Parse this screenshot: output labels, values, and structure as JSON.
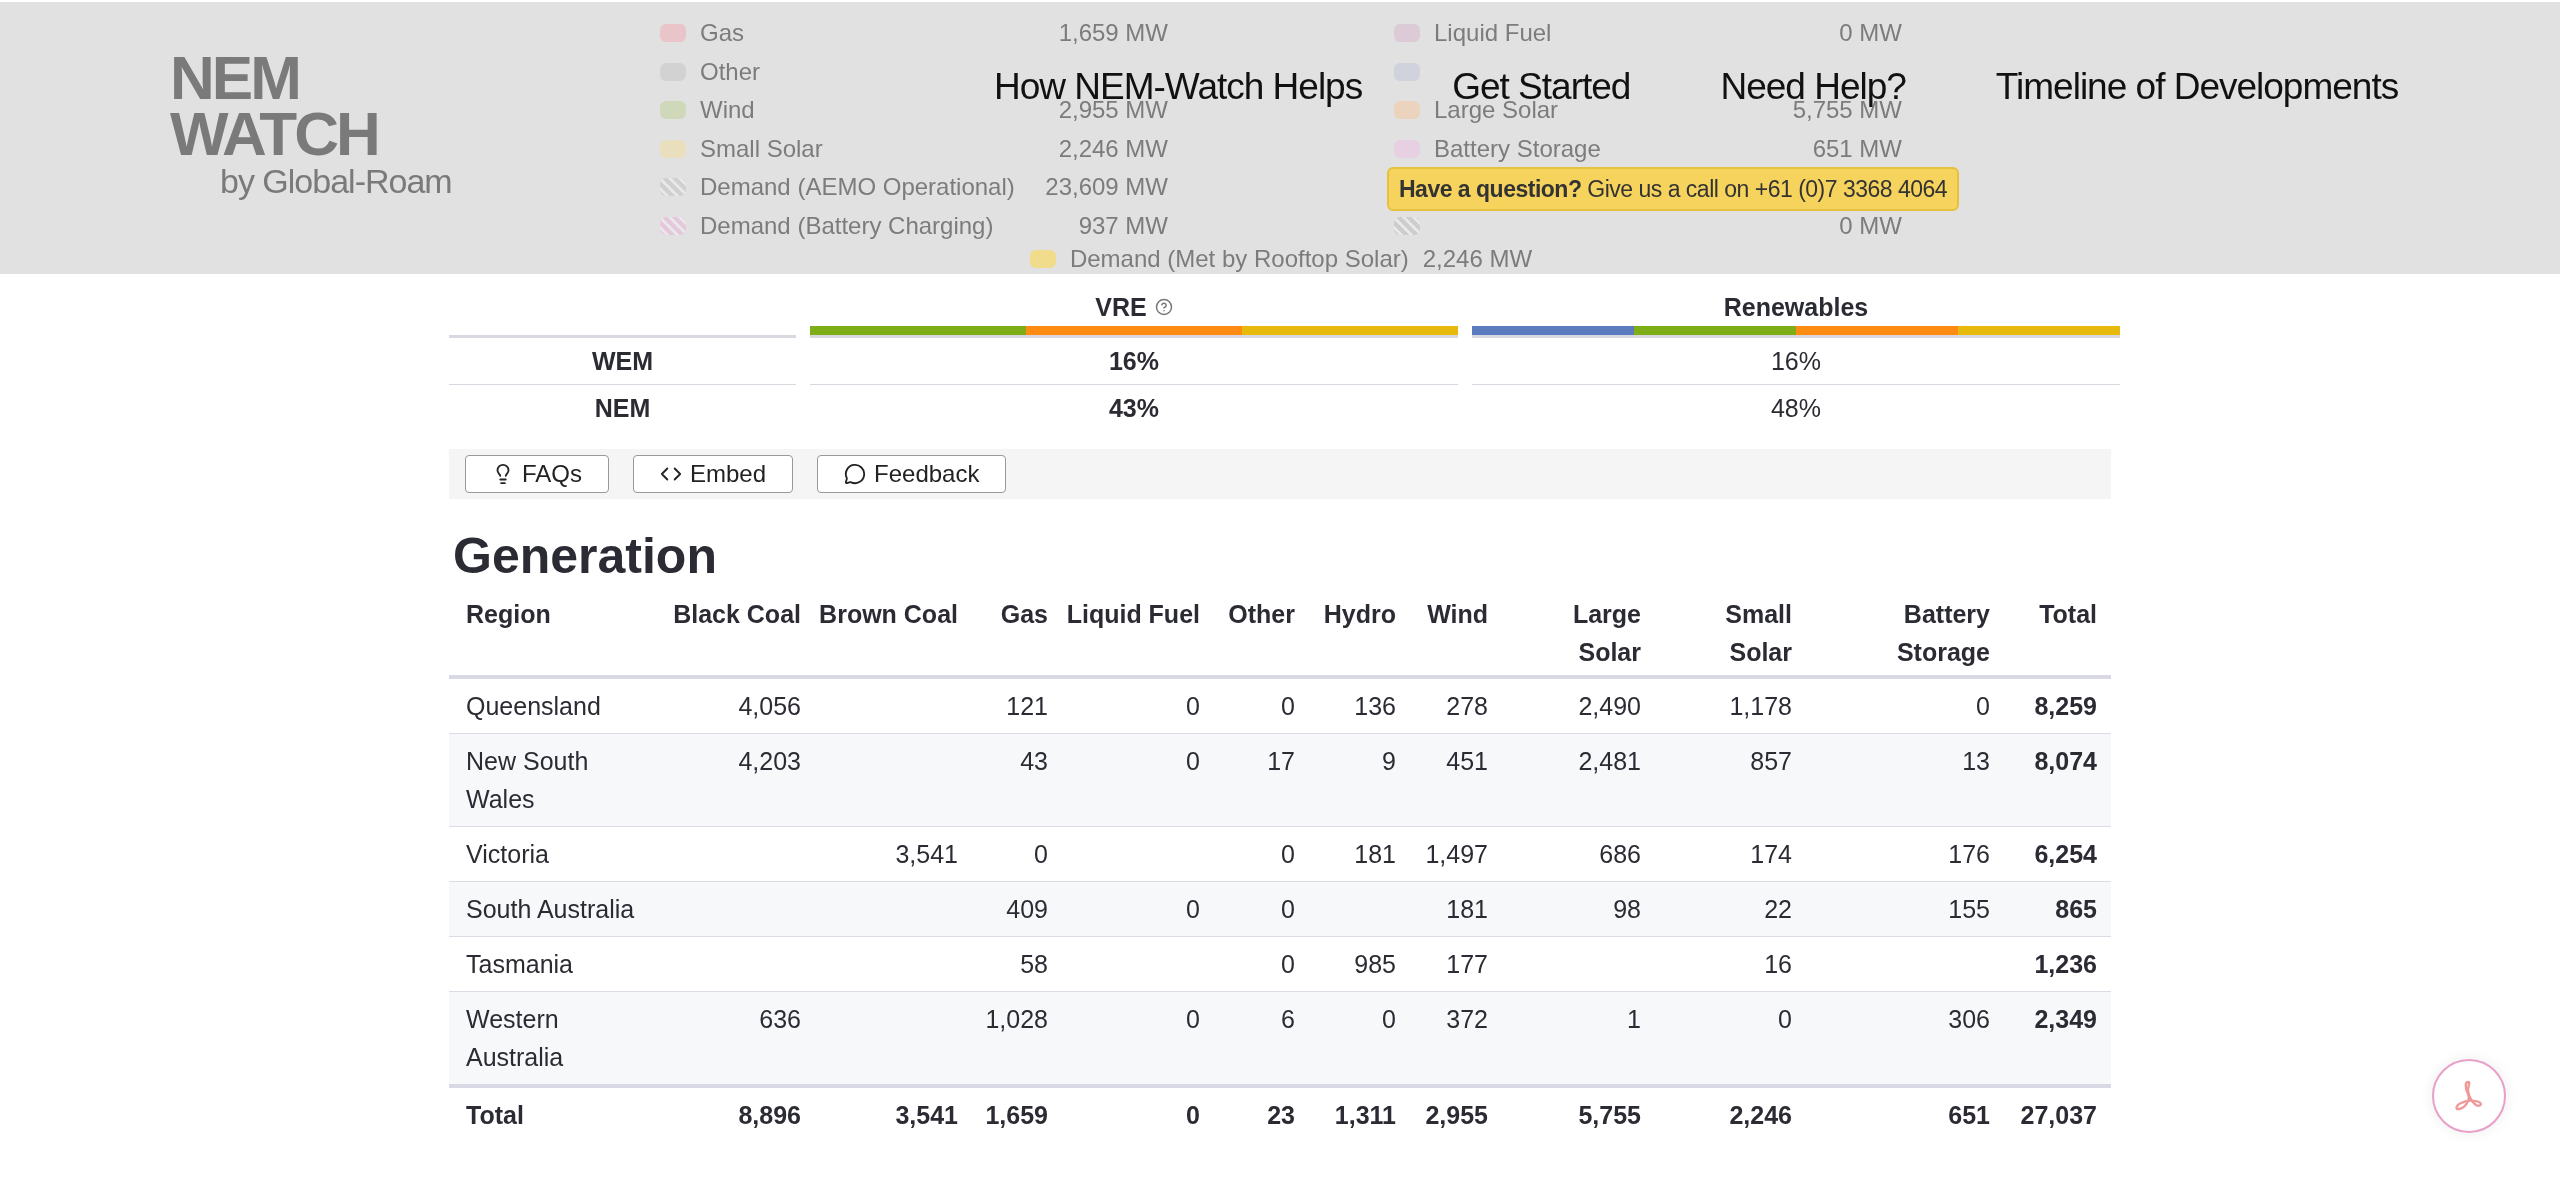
{
  "header": {
    "logo": {
      "top": "NEM",
      "bottom": "WATCH",
      "tagline": "by Global-Roam"
    },
    "nav": [
      {
        "label": "How NEM-Watch Helps"
      },
      {
        "label": "Get Started"
      },
      {
        "label": "Need Help?"
      },
      {
        "label": "Timeline of Developments"
      }
    ],
    "banner": {
      "lead": "Have a question?",
      "text": "Give us a call on +61 (0)7 3368 4064"
    }
  },
  "legend": {
    "rows": [
      {
        "left": {
          "label": "Gas",
          "value": "1,659 MW",
          "color": "#e9c4c8",
          "kind": "solid"
        },
        "right": {
          "label": "Liquid Fuel",
          "value": "0 MW",
          "color": "#dccbd6",
          "kind": "solid"
        }
      },
      {
        "left": {
          "label": "Other",
          "color": "#d2d2d2",
          "kind": "solid"
        },
        "right": {
          "color": "#d0d2dc",
          "kind": "solid"
        }
      },
      {
        "left": {
          "label": "Wind",
          "value": "2,955 MW",
          "color": "#cfd9b9",
          "kind": "solid"
        },
        "right": {
          "label": "Large Solar",
          "value": "5,755 MW",
          "color": "#ebd3bd",
          "kind": "solid"
        }
      },
      {
        "left": {
          "label": "Small Solar",
          "value": "2,246 MW",
          "color": "#e9dfbd",
          "kind": "solid"
        },
        "right": {
          "label": "Battery Storage",
          "value": "651 MW",
          "color": "#e7d0e2",
          "kind": "solid"
        }
      },
      {
        "left": {
          "label": "Demand (AEMO Operational)",
          "value": "23,609 MW",
          "color": "#d0d0d0",
          "kind": "hatched"
        }
      },
      {
        "left": {
          "label": "Demand (Battery Charging)",
          "value": "937 MW",
          "color": "#e6c8dc",
          "kind": "hatched"
        },
        "right": {
          "value": "0 MW",
          "color": "#cdcdcd",
          "kind": "hatched"
        }
      }
    ],
    "footer": {
      "label": "Demand (Met by Rooftop Solar)",
      "value": "2,246 MW",
      "color": "#f0dc8a",
      "kind": "solid"
    }
  },
  "share": {
    "columns": [
      {
        "label": "VRE",
        "help": true,
        "segments": [
          {
            "color": "#7fad16"
          },
          {
            "color": "#ff8c12"
          },
          {
            "color": "#e7b90c"
          }
        ]
      },
      {
        "label": "Renewables",
        "help": false,
        "segments": [
          {
            "color": "#5a7cbf"
          },
          {
            "color": "#7fad16"
          },
          {
            "color": "#ff8c12"
          },
          {
            "color": "#e7b90c"
          }
        ]
      }
    ],
    "rows": [
      {
        "label": "WEM",
        "vre": "16%",
        "renewables": "16%"
      },
      {
        "label": "NEM",
        "vre": "43%",
        "renewables": "48%"
      }
    ]
  },
  "toolbar": [
    {
      "kind": "faq",
      "label": "FAQs"
    },
    {
      "kind": "embed",
      "label": "Embed"
    },
    {
      "kind": "feedback",
      "label": "Feedback"
    }
  ],
  "generation": {
    "title": "Generation",
    "columns": [
      "Region",
      "Black Coal",
      "Brown Coal",
      "Gas",
      "Liquid Fuel",
      "Other",
      "Hydro",
      "Wind",
      "Large Solar",
      "Small Solar",
      "Battery Storage",
      "Total"
    ],
    "rows": [
      [
        "Queensland",
        "4,056",
        "",
        "121",
        "0",
        "0",
        "136",
        "278",
        "2,490",
        "1,178",
        "0",
        "8,259"
      ],
      [
        "New South Wales",
        "4,203",
        "",
        "43",
        "0",
        "17",
        "9",
        "451",
        "2,481",
        "857",
        "13",
        "8,074"
      ],
      [
        "Victoria",
        "",
        "3,541",
        "0",
        "",
        "0",
        "181",
        "1,497",
        "686",
        "174",
        "176",
        "6,254"
      ],
      [
        "South Australia",
        "",
        "",
        "409",
        "0",
        "0",
        "",
        "181",
        "98",
        "22",
        "155",
        "865"
      ],
      [
        "Tasmania",
        "",
        "",
        "58",
        "",
        "0",
        "985",
        "177",
        "",
        "16",
        "",
        "1,236"
      ],
      [
        "Western Australia",
        "636",
        "",
        "1,028",
        "0",
        "6",
        "0",
        "372",
        "1",
        "0",
        "306",
        "2,349"
      ]
    ],
    "total": [
      "Total",
      "8,896",
      "3,541",
      "1,659",
      "0",
      "23",
      "1,311",
      "2,955",
      "5,755",
      "2,246",
      "651",
      "27,037"
    ]
  }
}
